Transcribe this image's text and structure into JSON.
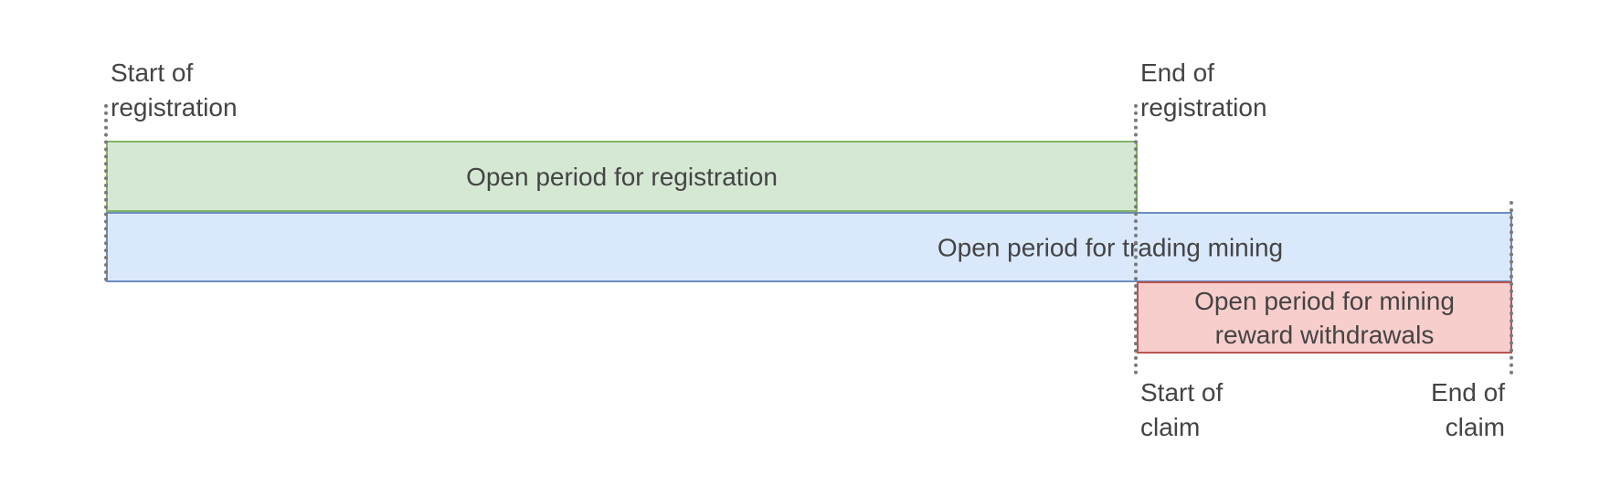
{
  "colors": {
    "registration_fill": "#d5e8d4",
    "registration_border": "#82b366",
    "trading_fill": "#dae8fc",
    "trading_border": "#6c8ebf",
    "withdrawal_fill": "#f8cecc",
    "withdrawal_border": "#b85450",
    "marker": "#7a7a7a",
    "text": "#444444"
  },
  "periods": {
    "registration": "Open period for registration",
    "trading": "Open period for trading mining",
    "withdrawal_line1": "Open period for mining",
    "withdrawal_line2": "reward withdrawals"
  },
  "milestones": {
    "start_registration": [
      "Start of",
      "registration"
    ],
    "end_registration": [
      "End of",
      "registration"
    ],
    "start_claim": [
      "Start of",
      "claim"
    ],
    "end_claim": [
      "End of",
      "claim"
    ]
  }
}
